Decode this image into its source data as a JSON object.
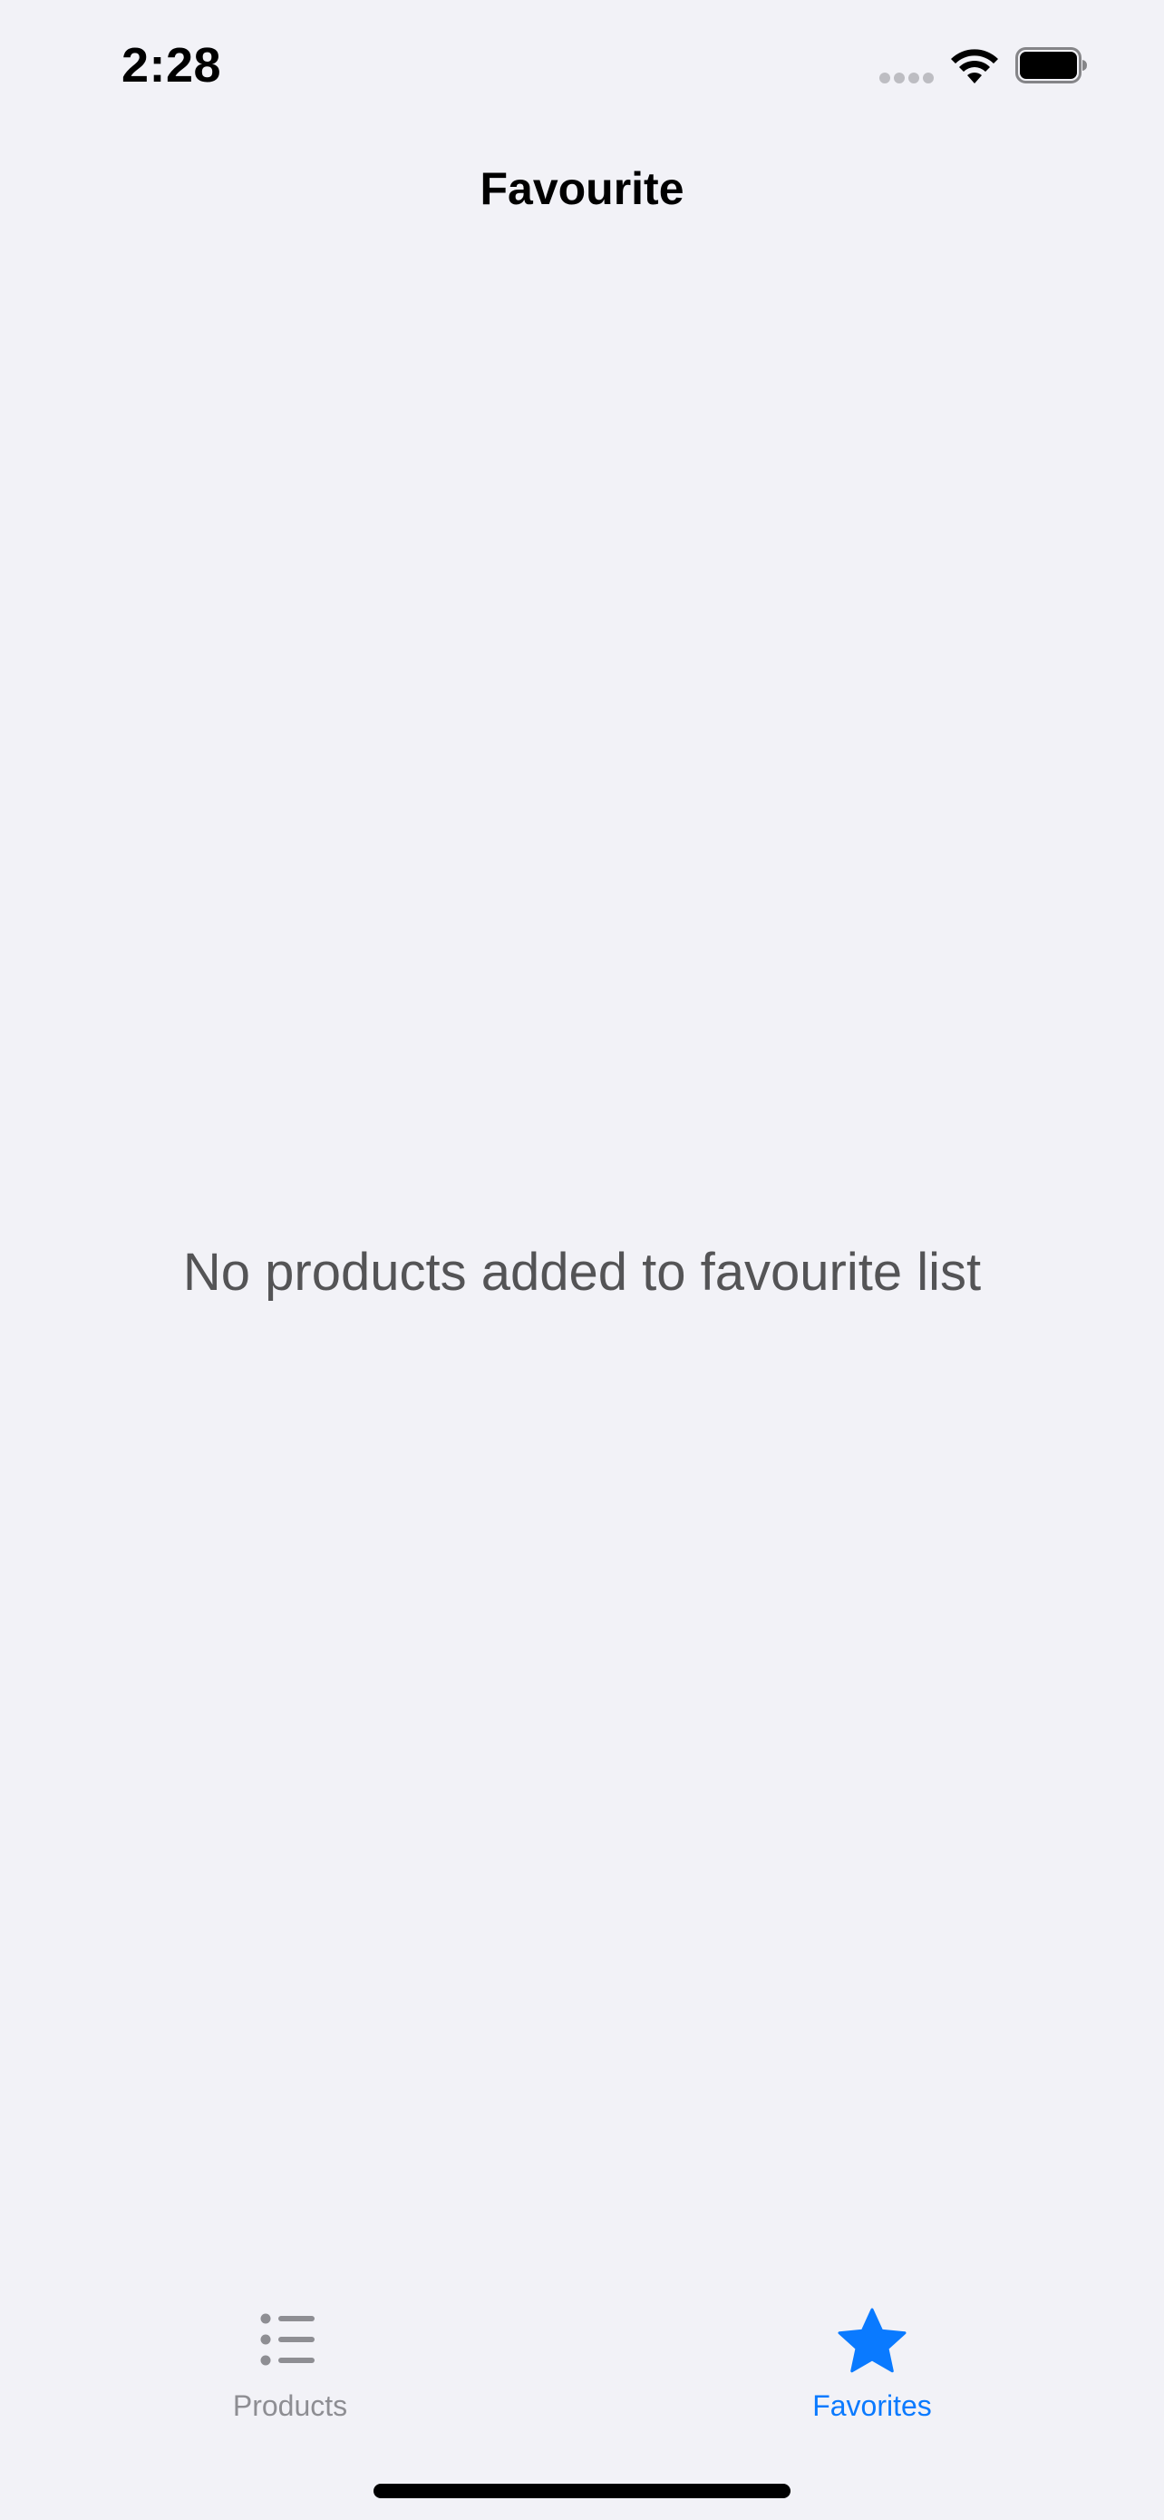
{
  "status_bar": {
    "time": "2:28",
    "signal_icon": "signal-dots-icon",
    "wifi_icon": "wifi-icon",
    "battery_icon": "battery-icon"
  },
  "nav": {
    "title": "Favourite"
  },
  "empty_state": {
    "message": "No products added to favourite list"
  },
  "tab_bar": {
    "tabs": [
      {
        "label": "Products",
        "icon": "list-bullet-icon",
        "selected": false
      },
      {
        "label": "Favorites",
        "icon": "star-icon",
        "selected": true
      }
    ]
  },
  "colors": {
    "background": "#F2F2F7",
    "accent": "#0A7AFF",
    "inactive_tab": "#8E8E93",
    "empty_text": "#545456"
  }
}
